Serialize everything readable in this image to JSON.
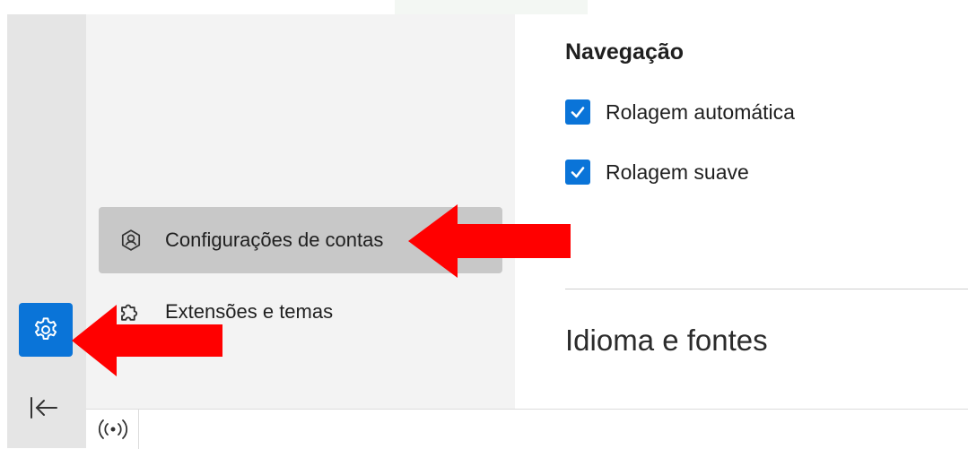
{
  "sidebar": {
    "items": [
      {
        "label": "Configurações de contas",
        "icon": "account-shield-icon",
        "selected": true
      },
      {
        "label": "Extensões e temas",
        "icon": "puzzle-icon",
        "selected": false
      }
    ]
  },
  "rail": {
    "settings_icon": "gear-icon",
    "collapse_icon": "collapse-left-icon"
  },
  "statusbar": {
    "icon": "wireless-icon"
  },
  "content": {
    "section_title": "Navegação",
    "checkboxes": [
      {
        "label": "Rolagem automática",
        "checked": true
      },
      {
        "label": "Rolagem suave",
        "checked": true
      }
    ],
    "next_section_heading": "Idioma e fontes"
  },
  "annotations": {
    "arrow_color": "#ff0000"
  },
  "colors": {
    "accent": "#0a74d8",
    "sidebar_bg": "#f3f3f3",
    "selected_bg": "#c8c8c8"
  }
}
